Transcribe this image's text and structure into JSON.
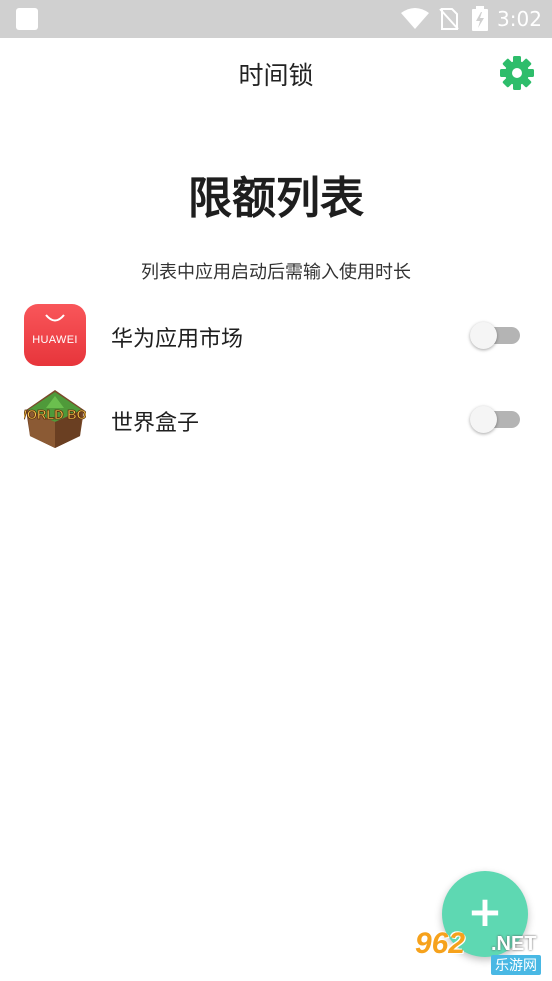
{
  "status_bar": {
    "time": "3:02",
    "icons": [
      "notification-square-icon",
      "wifi-icon",
      "no-sim-icon",
      "battery-charging-icon"
    ]
  },
  "app_bar": {
    "title": "时间锁",
    "settings_icon": "gear-icon",
    "accent_color": "#2ebd6b"
  },
  "main": {
    "heading": "限额列表",
    "subheading": "列表中应用启动后需输入使用时长",
    "apps": [
      {
        "name": "华为应用市场",
        "icon": "huawei-appgallery-icon",
        "icon_text": "HUAWEI",
        "enabled": false
      },
      {
        "name": "世界盒子",
        "icon": "worldbox-icon",
        "icon_text": "WORLD BOX",
        "enabled": false
      }
    ]
  },
  "fab": {
    "label": "+",
    "color": "#5ed8b2",
    "icon": "plus-icon"
  },
  "watermark": {
    "number": "962",
    "suffix": ".NET",
    "subtitle": "乐游网"
  }
}
